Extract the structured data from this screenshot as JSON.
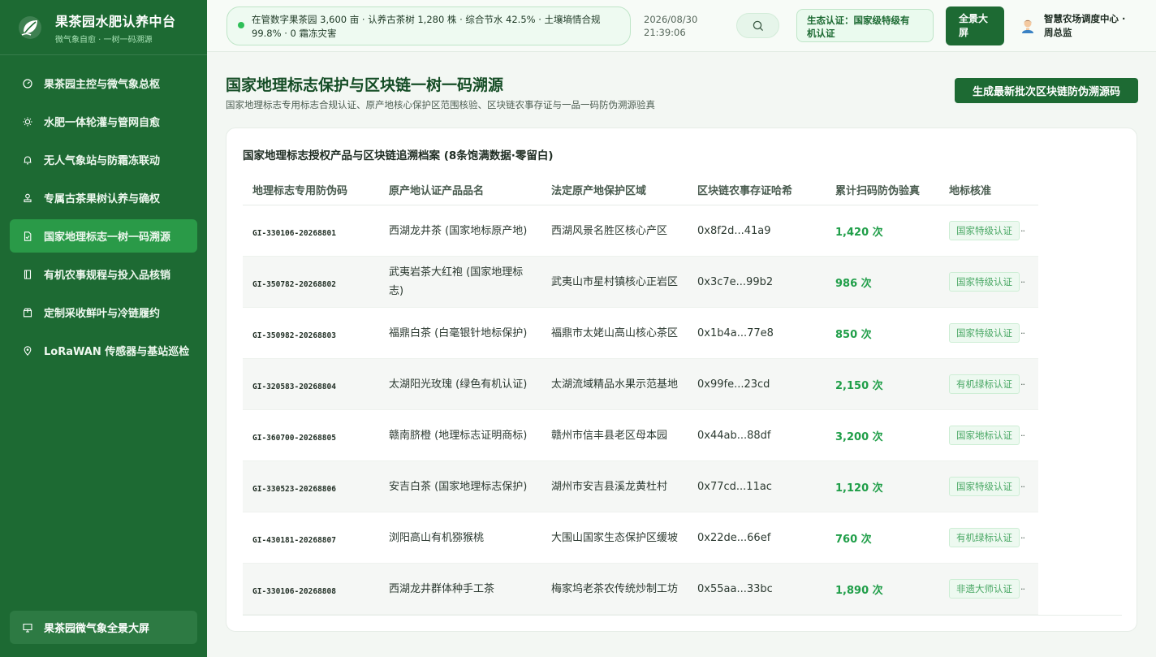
{
  "app": {
    "title": "果茶园水肥认养中台",
    "subtitle": "微气象自愈 · 一树一码溯源"
  },
  "sidebar": {
    "items": [
      {
        "label": "果茶园主控与微气象总枢",
        "icon": "gauge-icon"
      },
      {
        "label": "水肥一体轮灌与管网自愈",
        "icon": "sun-icon"
      },
      {
        "label": "无人气象站与防霜冻联动",
        "icon": "bell-icon"
      },
      {
        "label": "专属古茶果树认养与确权",
        "icon": "stamp-icon"
      },
      {
        "label": "国家地理标志一树一码溯源",
        "icon": "document-check-icon",
        "active": true
      },
      {
        "label": "有机农事规程与投入品核销",
        "icon": "book-icon"
      },
      {
        "label": "定制采收鲜叶与冷链履约",
        "icon": "package-icon"
      },
      {
        "label": "LoRaWAN 传感器与基站巡检",
        "icon": "pin-icon"
      }
    ],
    "bottom_label": "果茶园微气象全景大屏",
    "bottom_icon": "monitor-icon"
  },
  "header": {
    "ticker_line1": "在管数字果茶园 3,600 亩 · 认养古茶树 1,280 株 · 综合节水 42.5% · 土壤墒情合规",
    "ticker_line2": "99.8% · 0 霜冻灾害",
    "date": "2026/08/30",
    "time": "21:39:06",
    "eco_line1": "生态认证：国家级特级有",
    "eco_line2": "机认证",
    "panorama_line1": "全景大",
    "panorama_line2": "屏",
    "user_line1": "智慧农场调度中心 ·",
    "user_line2": "周总监"
  },
  "page": {
    "title": "国家地理标志保护与区块链一树一码溯源",
    "description": "国家地理标志专用标志合规认证、原产地核心保护区范围核验、区块链农事存证与一品一码防伪溯源验真",
    "generate_button": "生成最新批次区块链防伪溯源码"
  },
  "card": {
    "title": "国家地理标志授权产品与区块链追溯档案 (8条饱满数据·零留白)"
  },
  "table": {
    "columns": [
      "地理标志专用防伪码",
      "原产地认证产品品名",
      "法定原产地保护区域",
      "区块链农事存证哈希",
      "累计扫码防伪验真",
      "地标核准"
    ],
    "rows": [
      {
        "code": "GI-330106-20268801",
        "product": "西湖龙井茶 (国家地标原产地)",
        "region": "西湖风景名胜区核心产区",
        "hash": "0x8f2d...41a9",
        "scans": "1,420 次",
        "status": "国家特级认证",
        "more": "··"
      },
      {
        "code": "GI-350782-20268802",
        "product": "武夷岩茶大红袍 (国家地理标志)",
        "region": "武夷山市星村镇核心正岩区",
        "hash": "0x3c7e...99b2",
        "scans": "986 次",
        "status": "国家特级认证",
        "more": "··"
      },
      {
        "code": "GI-350982-20268803",
        "product": "福鼎白茶 (白毫银针地标保护)",
        "region": "福鼎市太姥山高山核心茶区",
        "hash": "0x1b4a...77e8",
        "scans": "850 次",
        "status": "国家特级认证",
        "more": "··"
      },
      {
        "code": "GI-320583-20268804",
        "product": "太湖阳光玫瑰 (绿色有机认证)",
        "region": "太湖流域精品水果示范基地",
        "hash": "0x99fe...23cd",
        "scans": "2,150 次",
        "status": "有机绿标认证",
        "more": "··"
      },
      {
        "code": "GI-360700-20268805",
        "product": "赣南脐橙 (地理标志证明商标)",
        "region": "赣州市信丰县老区母本园",
        "hash": "0x44ab...88df",
        "scans": "3,200 次",
        "status": "国家地标认证",
        "more": "··"
      },
      {
        "code": "GI-330523-20268806",
        "product": "安吉白茶 (国家地理标志保护)",
        "region": "湖州市安吉县溪龙黄杜村",
        "hash": "0x77cd...11ac",
        "scans": "1,120 次",
        "status": "国家特级认证",
        "more": "··"
      },
      {
        "code": "GI-430181-20268807",
        "product": "浏阳高山有机猕猴桃",
        "region": "大围山国家生态保护区缓坡",
        "hash": "0x22de...66ef",
        "scans": "760 次",
        "status": "有机绿标认证",
        "more": "··"
      },
      {
        "code": "GI-330106-20268808",
        "product": "西湖龙井群体种手工茶",
        "region": "梅家坞老茶农传统炒制工坊",
        "hash": "0x55aa...33bc",
        "scans": "1,890 次",
        "status": "非遗大师认证",
        "more": "··"
      }
    ]
  },
  "colors": {
    "sidebar_bg": "#1d6a33",
    "active_item": "#2a9a48",
    "accent_green": "#1f9e48",
    "status_dot": "#2fbf58"
  }
}
